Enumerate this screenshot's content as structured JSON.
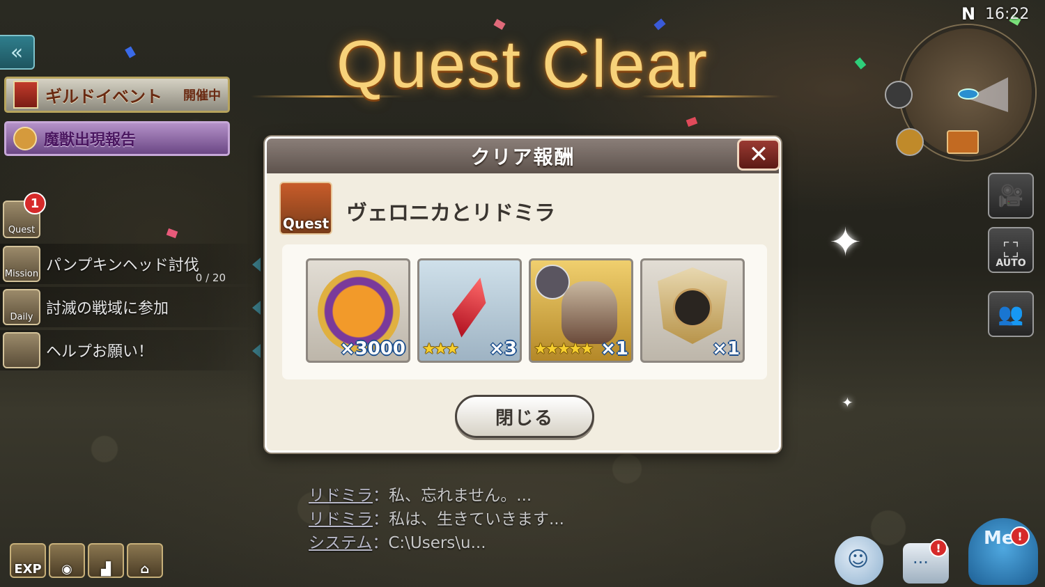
{
  "banner": {
    "title": "Quest Clear"
  },
  "status": {
    "compass": "N",
    "clock": "16:22"
  },
  "left_panel": {
    "back_label": "«",
    "guild_event": {
      "label": "ギルドイベント",
      "status": "開催中"
    },
    "beast_report": {
      "label": "魔獣出現報告"
    },
    "quest_badge": "1",
    "quest_tag": "Quest",
    "missions": [
      {
        "tag": "Mission",
        "text": "パンプキンヘッド討伐",
        "progress": "0 / 20"
      },
      {
        "tag": "Daily",
        "text": "討滅の戦域に参加",
        "progress": ""
      },
      {
        "tag": "",
        "text": "ヘルプお願い！",
        "progress": ""
      }
    ],
    "bottom_buttons": [
      {
        "name": "exp-boost",
        "label": "EXP"
      },
      {
        "name": "gold-boost",
        "label": ""
      },
      {
        "name": "drop-boost",
        "label": ""
      },
      {
        "name": "cage",
        "label": ""
      }
    ]
  },
  "right_panel": {
    "auto_label": "AUTO"
  },
  "dialog": {
    "title": "クリア報酬",
    "close_x": "✕",
    "quest_icon_label": "Quest",
    "quest_name": "ヴェロニカとリドミラ",
    "rewards": [
      {
        "name": "pumpkin-medal",
        "qty": "×3000",
        "stars": ""
      },
      {
        "name": "red-crystal",
        "qty": "×3",
        "stars": "★★★"
      },
      {
        "name": "zombie-unit",
        "qty": "×1",
        "stars": "★★★★★"
      },
      {
        "name": "emblem",
        "qty": "×1",
        "stars": ""
      }
    ],
    "close_button": "閉じる"
  },
  "chat": [
    {
      "speaker": "リドミラ",
      "sep": "：",
      "text": "私、忘れません。..."
    },
    {
      "speaker": "リドミラ",
      "sep": "：",
      "text": "私は、生きていきます..."
    },
    {
      "speaker": "システム",
      "sep": "：",
      "text": "C:\\Users\\u..."
    }
  ],
  "bottom_right": {
    "menu_label": "Me",
    "menu_badge": "!",
    "chat_badge": "!"
  }
}
